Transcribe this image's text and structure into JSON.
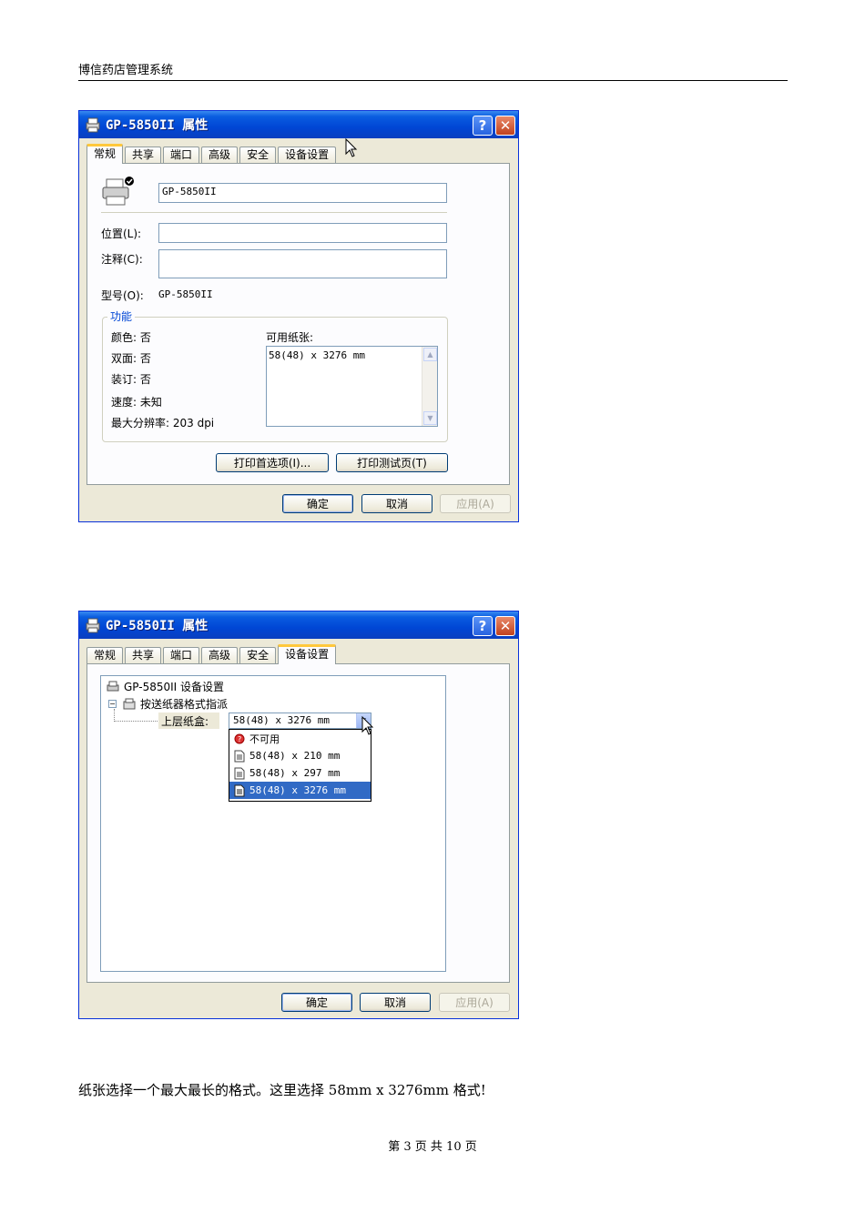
{
  "document": {
    "header": "博信药店管理系统",
    "body_text": "纸张选择一个最大最长的格式。这里选择 58mm x 3276mm 格式!",
    "footer": "第 3 页 共 10 页"
  },
  "window1": {
    "title": "GP-5850II 属性",
    "tabs": [
      "常规",
      "共享",
      "端口",
      "高级",
      "安全",
      "设备设置"
    ],
    "active_tab": "常规",
    "printer_name": "GP-5850II",
    "location_label": "位置(L):",
    "location_value": "",
    "comment_label": "注释(C):",
    "comment_value": "",
    "model_label": "型号(O):",
    "model_value": "GP-5850II",
    "features_title": "功能",
    "features": {
      "color": "颜色: 否",
      "duplex": "双面: 否",
      "staple": "装订: 否",
      "speed": "速度: 未知",
      "resolution": "最大分辨率: 203 dpi"
    },
    "paper_label": "可用纸张:",
    "paper_items": [
      "58(48) x 3276 mm"
    ],
    "pref_button": "打印首选项(I)...",
    "test_button": "打印测试页(T)",
    "ok_button": "确定",
    "cancel_button": "取消",
    "apply_button": "应用(A)"
  },
  "window2": {
    "title": "GP-5850II 属性",
    "tabs": [
      "常规",
      "共享",
      "端口",
      "高级",
      "安全",
      "设备设置"
    ],
    "active_tab": "设备设置",
    "tree_root": "GP-5850II 设备设置",
    "tree_child": "按送纸器格式指派",
    "tray_label": "上层纸盒:",
    "tray_value": "58(48) x 3276 mm",
    "dropdown_options": [
      "不可用",
      "58(48) x 210 mm",
      "58(48) x 297 mm",
      "58(48) x 3276 mm"
    ],
    "selected_option": "58(48) x 3276 mm",
    "ok_button": "确定",
    "cancel_button": "取消",
    "apply_button": "应用(A)"
  },
  "colors": {
    "titlebar": "#0046d5",
    "selection": "#316ac5",
    "dialog_bg": "#ece9d8",
    "tab_highlight": "#ffc83c"
  }
}
